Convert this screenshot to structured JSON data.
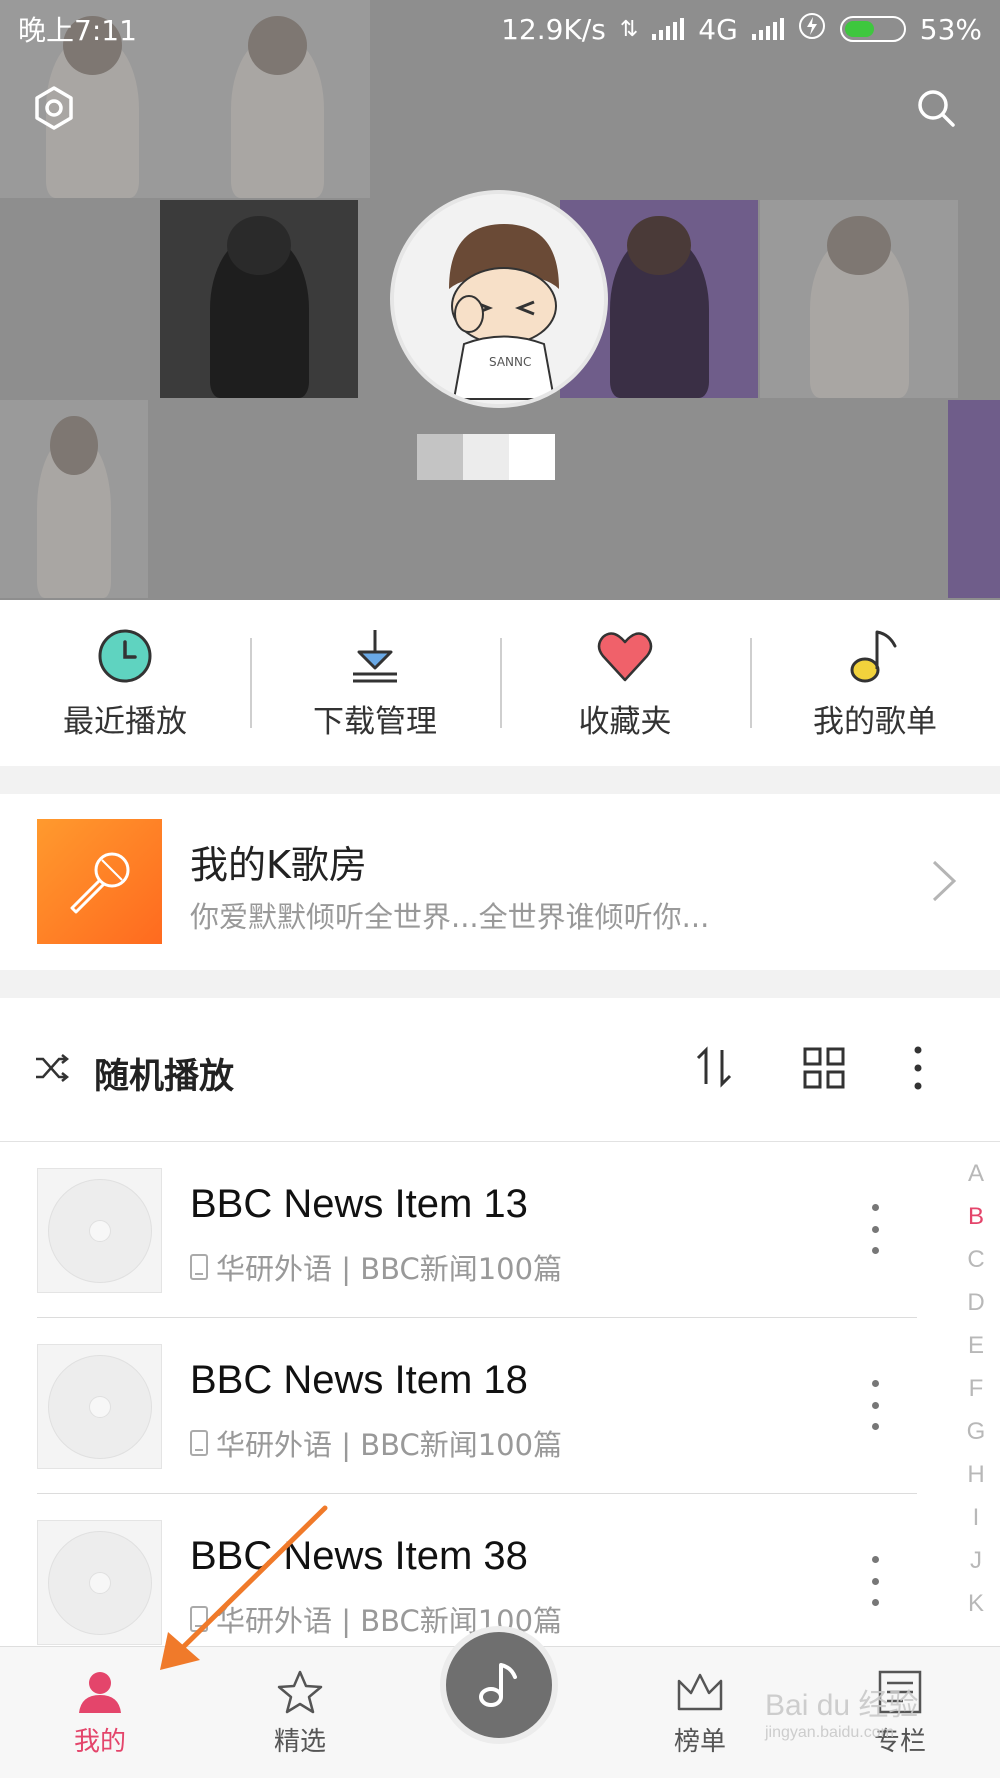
{
  "status_bar": {
    "time": "晚上7:11",
    "network_speed": "12.9K/s",
    "network_type": "4G",
    "battery": "53%",
    "battery_level": 0.53
  },
  "header": {
    "settings_icon": "settings-hexagon-icon",
    "search_icon": "search-icon",
    "avatar_icon": "cartoon-avatar"
  },
  "quick_actions": [
    {
      "label": "最近播放",
      "icon": "clock-icon",
      "color": "#5fd3c0"
    },
    {
      "label": "下载管理",
      "icon": "download-icon",
      "color": "#6aa9e6"
    },
    {
      "label": "收藏夹",
      "icon": "heart-icon",
      "color": "#f0616a"
    },
    {
      "label": "我的歌单",
      "icon": "music-note-icon",
      "color": "#f2d33c"
    }
  ],
  "karaoke": {
    "title": "我的K歌房",
    "subtitle": "你爱默默倾听全世界...全世界谁倾听你..."
  },
  "toolbar": {
    "shuffle_label": "随机播放"
  },
  "songs": [
    {
      "title": "BBC News Item 13",
      "meta": "华研外语 | BBC新闻100篇"
    },
    {
      "title": "BBC News Item 18",
      "meta": "华研外语 | BBC新闻100篇"
    },
    {
      "title": "BBC News Item 38",
      "meta": "华研外语 | BBC新闻100篇"
    }
  ],
  "alphabet_index": [
    "A",
    "B",
    "C",
    "D",
    "E",
    "F",
    "G",
    "H",
    "I",
    "J",
    "K"
  ],
  "alphabet_active": "B",
  "nav": {
    "mine": "我的",
    "featured": "精选",
    "charts": "榜单",
    "column": "专栏"
  },
  "colors": {
    "accent": "#e4456b",
    "karaoke_orange": "#ff7a22",
    "annotation_arrow": "#f07a2a"
  },
  "watermark": {
    "brand": "Bai du 经验",
    "url": "jingyan.baidu.com"
  }
}
